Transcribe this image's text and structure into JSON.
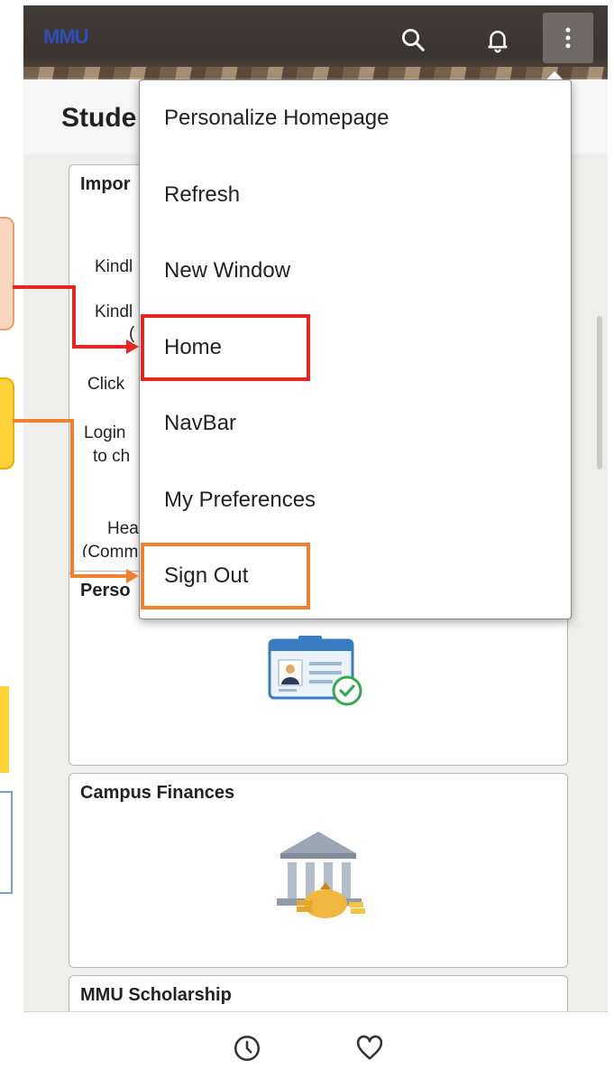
{
  "app": {
    "logo_text": "MMU",
    "page_title": "Stude"
  },
  "topbar": {
    "icons": [
      "search-icon",
      "bell-icon",
      "more-vertical-icon"
    ]
  },
  "tiles": {
    "important": {
      "title": "Impor",
      "lines": [
        "Kindl",
        "Kindl",
        "(",
        "Click",
        "Login",
        "to ch",
        "Hea",
        "(Comm"
      ]
    },
    "personal": {
      "title": "Perso"
    },
    "finances": {
      "title": "Campus Finances"
    },
    "scholarship": {
      "title": "MMU Scholarship"
    }
  },
  "menu": {
    "items": [
      {
        "label": "Personalize Homepage"
      },
      {
        "label": "Refresh"
      },
      {
        "label": "New Window"
      },
      {
        "label": "Home"
      },
      {
        "label": "NavBar"
      },
      {
        "label": "My Preferences"
      },
      {
        "label": "Sign Out"
      }
    ]
  },
  "bottombar": {
    "icons": [
      "history-clock-icon",
      "favorites-heart-icon"
    ]
  },
  "colors": {
    "highlight_home": "#e8251e",
    "highlight_signout": "#f08030",
    "topbar": "#3b3531"
  }
}
